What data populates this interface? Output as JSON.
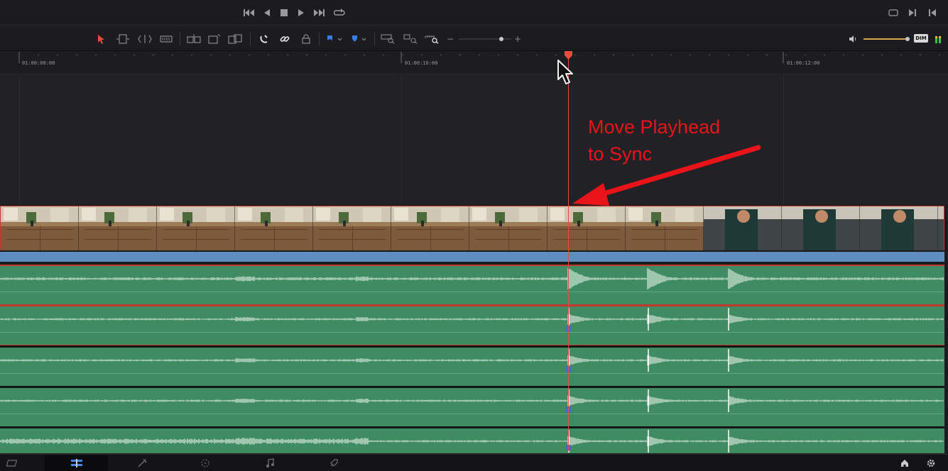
{
  "transport": {
    "buttons": [
      "skip-to-start-icon",
      "play-reverse-icon",
      "stop-icon",
      "play-icon",
      "skip-to-end-icon",
      "loop-icon"
    ],
    "right_buttons": [
      "fullscreen-icon",
      "next-edit-icon",
      "prev-edit-icon"
    ]
  },
  "toolbar": {
    "tools": [
      "selection-pointer-icon",
      "trim-edit-icon",
      "dynamic-trim-icon",
      "blade-icon",
      "insert-clip-icon",
      "overwrite-clip-icon",
      "replace-clip-icon",
      "snapping-icon",
      "linked-selection-icon",
      "position-lock-icon",
      "flag-icon",
      "marker-icon",
      "zoom-full-icon",
      "zoom-detail-icon",
      "zoom-custom-icon"
    ],
    "zoom_minus": "−",
    "zoom_plus": "+",
    "dim_label": "DIM",
    "accent_color": "#e74c3c",
    "volume_color": "#d8a74a"
  },
  "ruler": {
    "timecodes": [
      "01:00:08:00",
      "01:00:10:00",
      "01:00:12:00"
    ]
  },
  "annotation": {
    "line1": "Move Playhead",
    "line2": "to Sync",
    "color": "#e8141a"
  },
  "tracks": {
    "video_color": "#5b4536",
    "video_bar_color": "#5f8dc0",
    "audio_color": "#3f8b62",
    "audio_count": 5
  },
  "bottom_bar": {
    "pages": [
      "media-page-icon",
      "edit-page-icon",
      "fusion-page-icon",
      "color-page-icon",
      "fairlight-page-icon",
      "deliver-page-icon"
    ],
    "active_page": "edit-page-icon",
    "right": [
      "home-icon",
      "settings-icon"
    ]
  }
}
